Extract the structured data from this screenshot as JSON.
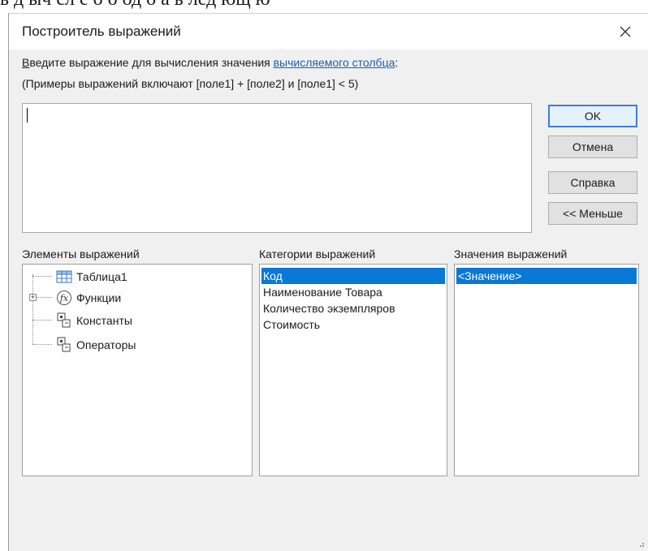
{
  "background_text": "ь д  ыч сл  е о  о  од о  а   ь  лед ющ   ю",
  "dialog": {
    "title": "Построитель выражений",
    "prompt": {
      "prefix_underlined": "В",
      "prefix_rest": "ведите выражение для вычисления значения ",
      "link": "вычисляемого столбца",
      "suffix": ":"
    },
    "example": "(Примеры выражений включают [поле1] + [поле2] и [поле1] < 5)",
    "expression_value": "",
    "buttons": {
      "ok": "OK",
      "cancel": "Отмена",
      "help": "Справка",
      "less": "<< Меньше"
    },
    "columns": {
      "elements": "Элементы выражений",
      "categories": "Категории выражений",
      "values": "Значения выражений"
    },
    "tree": [
      {
        "label": "Таблица1",
        "icon": "table-icon"
      },
      {
        "label": "Функции",
        "icon": "function-icon"
      },
      {
        "label": "Константы",
        "icon": "constants-icon"
      },
      {
        "label": "Операторы",
        "icon": "operators-icon"
      }
    ],
    "categories": [
      "Код",
      "Наименование Товара",
      "Количество экземпляров",
      "Стоимость"
    ],
    "values": [
      "<Значение>"
    ]
  },
  "colors": {
    "selection": "#0a78d7",
    "link": "#1a5fb4",
    "dialog_bg": "#f0f0f0"
  }
}
